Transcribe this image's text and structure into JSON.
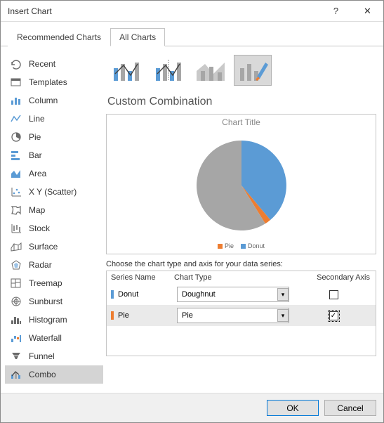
{
  "window_title": "Insert Chart",
  "tabs": {
    "recommended": "Recommended Charts",
    "all": "All Charts"
  },
  "sidebar": [
    {
      "label": "Recent",
      "icon": "recent"
    },
    {
      "label": "Templates",
      "icon": "templates"
    },
    {
      "label": "Column",
      "icon": "column"
    },
    {
      "label": "Line",
      "icon": "line"
    },
    {
      "label": "Pie",
      "icon": "pie"
    },
    {
      "label": "Bar",
      "icon": "bar"
    },
    {
      "label": "Area",
      "icon": "area"
    },
    {
      "label": "X Y (Scatter)",
      "icon": "scatter"
    },
    {
      "label": "Map",
      "icon": "map"
    },
    {
      "label": "Stock",
      "icon": "stock"
    },
    {
      "label": "Surface",
      "icon": "surface"
    },
    {
      "label": "Radar",
      "icon": "radar"
    },
    {
      "label": "Treemap",
      "icon": "treemap"
    },
    {
      "label": "Sunburst",
      "icon": "sunburst"
    },
    {
      "label": "Histogram",
      "icon": "histogram"
    },
    {
      "label": "Waterfall",
      "icon": "waterfall"
    },
    {
      "label": "Funnel",
      "icon": "funnel"
    },
    {
      "label": "Combo",
      "icon": "combo",
      "selected": true
    }
  ],
  "subtitle": "Custom Combination",
  "preview_title": "Chart Title",
  "legend": {
    "pie": "Pie",
    "donut": "Donut"
  },
  "choose_label": "Choose the chart type and axis for your data series:",
  "series_header": {
    "name": "Series Name",
    "type": "Chart Type",
    "axis": "Secondary Axis"
  },
  "series": [
    {
      "swatch": "#5b9bd5",
      "name": "Donut",
      "type": "Doughnut",
      "secondary": false
    },
    {
      "swatch": "#ed7d31",
      "name": "Pie",
      "type": "Pie",
      "secondary": true
    }
  ],
  "buttons": {
    "ok": "OK",
    "cancel": "Cancel"
  },
  "colors": {
    "blue": "#5b9bd5",
    "gray": "#a6a6a6",
    "orange": "#ed7d31"
  },
  "chart_data": {
    "type": "pie",
    "title": "Chart Title",
    "series": [
      {
        "name": "Donut",
        "color": "#5b9bd5",
        "value": 36
      },
      {
        "name": "(gray)",
        "color": "#a6a6a6",
        "value": 62
      },
      {
        "name": "Pie",
        "color": "#ed7d31",
        "value": 2
      }
    ],
    "legend_position": "bottom"
  }
}
